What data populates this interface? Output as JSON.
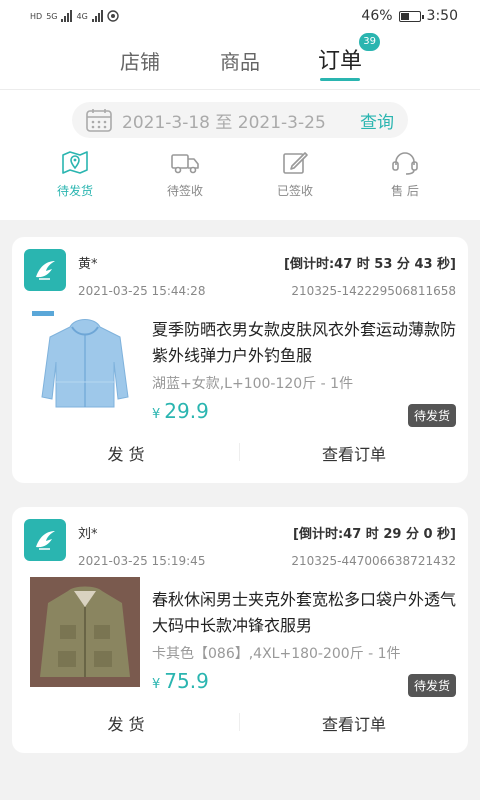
{
  "status_bar": {
    "left_labels": [
      "HD",
      "5G",
      "4G"
    ],
    "battery": "46%",
    "battery_level": 0.46,
    "time": "3:50"
  },
  "tabs": [
    {
      "label": "店铺"
    },
    {
      "label": "商品"
    },
    {
      "label": "订单",
      "badge": "39"
    }
  ],
  "date_filter": {
    "range": "2021-3-18 至 2021-3-25",
    "query_label": "查询"
  },
  "status_tabs": [
    {
      "label": "待发货",
      "icon": "map-pin-icon"
    },
    {
      "label": "待签收",
      "icon": "truck-icon"
    },
    {
      "label": "已签收",
      "icon": "edit-icon"
    },
    {
      "label": "售  后",
      "icon": "headset-icon"
    }
  ],
  "orders": [
    {
      "buyer": "黄*",
      "time": "2021-03-25 15:44:28",
      "countdown": "[倒计时:47 时 53 分 43 秒]",
      "order_no": "210325-142229506811658",
      "title": "夏季防晒衣男女款皮肤风衣外套运动薄款防紫外线弹力户外钓鱼服",
      "spec": "湖蓝+女款,L+100-120斤 - 1件",
      "currency": "¥",
      "price": "29.9",
      "status": "待发货",
      "action_left": "发  货",
      "action_right": "查看订单"
    },
    {
      "buyer": "刘*",
      "time": "2021-03-25 15:19:45",
      "countdown": "[倒计时:47 时 29 分 0 秒]",
      "order_no": "210325-447006638721432",
      "title": "春秋休闲男士夹克外套宽松多口袋户外透气大码中长款冲锋衣服男",
      "spec": "卡其色【086】,4XL+180-200斤 - 1件",
      "currency": "¥",
      "price": "75.9",
      "status": "待发货",
      "action_left": "发  货",
      "action_right": "查看订单"
    }
  ],
  "colors": {
    "accent": "#2ab5b0",
    "status_badge": "#555555"
  }
}
